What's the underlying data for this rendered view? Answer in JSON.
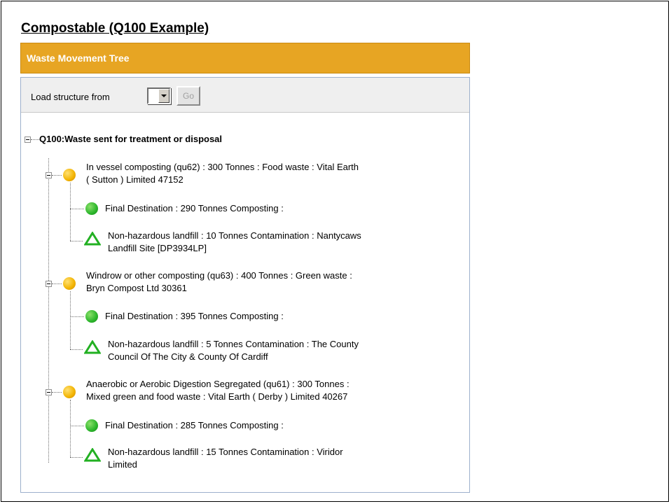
{
  "page": {
    "heading": "Compostable (Q100 Example)"
  },
  "panel": {
    "title": "Waste Movement Tree",
    "load_label": "Load structure from",
    "go_label": "Go"
  },
  "tree": {
    "root_label": "Q100:Waste sent for treatment or disposal",
    "groups": [
      {
        "line1": "In vessel composting (qu62) : 300 Tonnes : Food waste : Vital Earth",
        "line2": "( Sutton ) Limited 47152",
        "final": "Final Destination : 290 Tonnes Composting :",
        "landfill_line1": "Non-hazardous landfill : 10 Tonnes Contamination : Nantycaws",
        "landfill_line2": "Landfill Site [DP3934LP]"
      },
      {
        "line1": "Windrow or other composting (qu63) : 400 Tonnes : Green waste :",
        "line2": "Bryn Compost Ltd 30361",
        "final": "Final Destination : 395 Tonnes Composting :",
        "landfill_line1": "Non-hazardous landfill : 5 Tonnes Contamination : The County",
        "landfill_line2": "Council Of The City & County Of Cardiff"
      },
      {
        "line1": "Anaerobic or Aerobic Digestion Segregated (qu61) : 300 Tonnes :",
        "line2": "Mixed green and food waste : Vital Earth ( Derby ) Limited 40267",
        "final": "Final Destination : 285 Tonnes Composting :",
        "landfill_line1": "Non-hazardous landfill : 15 Tonnes Contamination : Viridor",
        "landfill_line2": "Limited"
      }
    ]
  },
  "icons": {
    "collapse": "minus-box-icon",
    "activity": "orange-circle-icon",
    "final_destination": "green-circle-icon",
    "landfill": "green-triangle-icon"
  },
  "colors": {
    "header_bg": "#e7a523",
    "panel_border": "#9db0cc",
    "toolbar_bg": "#efefef"
  }
}
